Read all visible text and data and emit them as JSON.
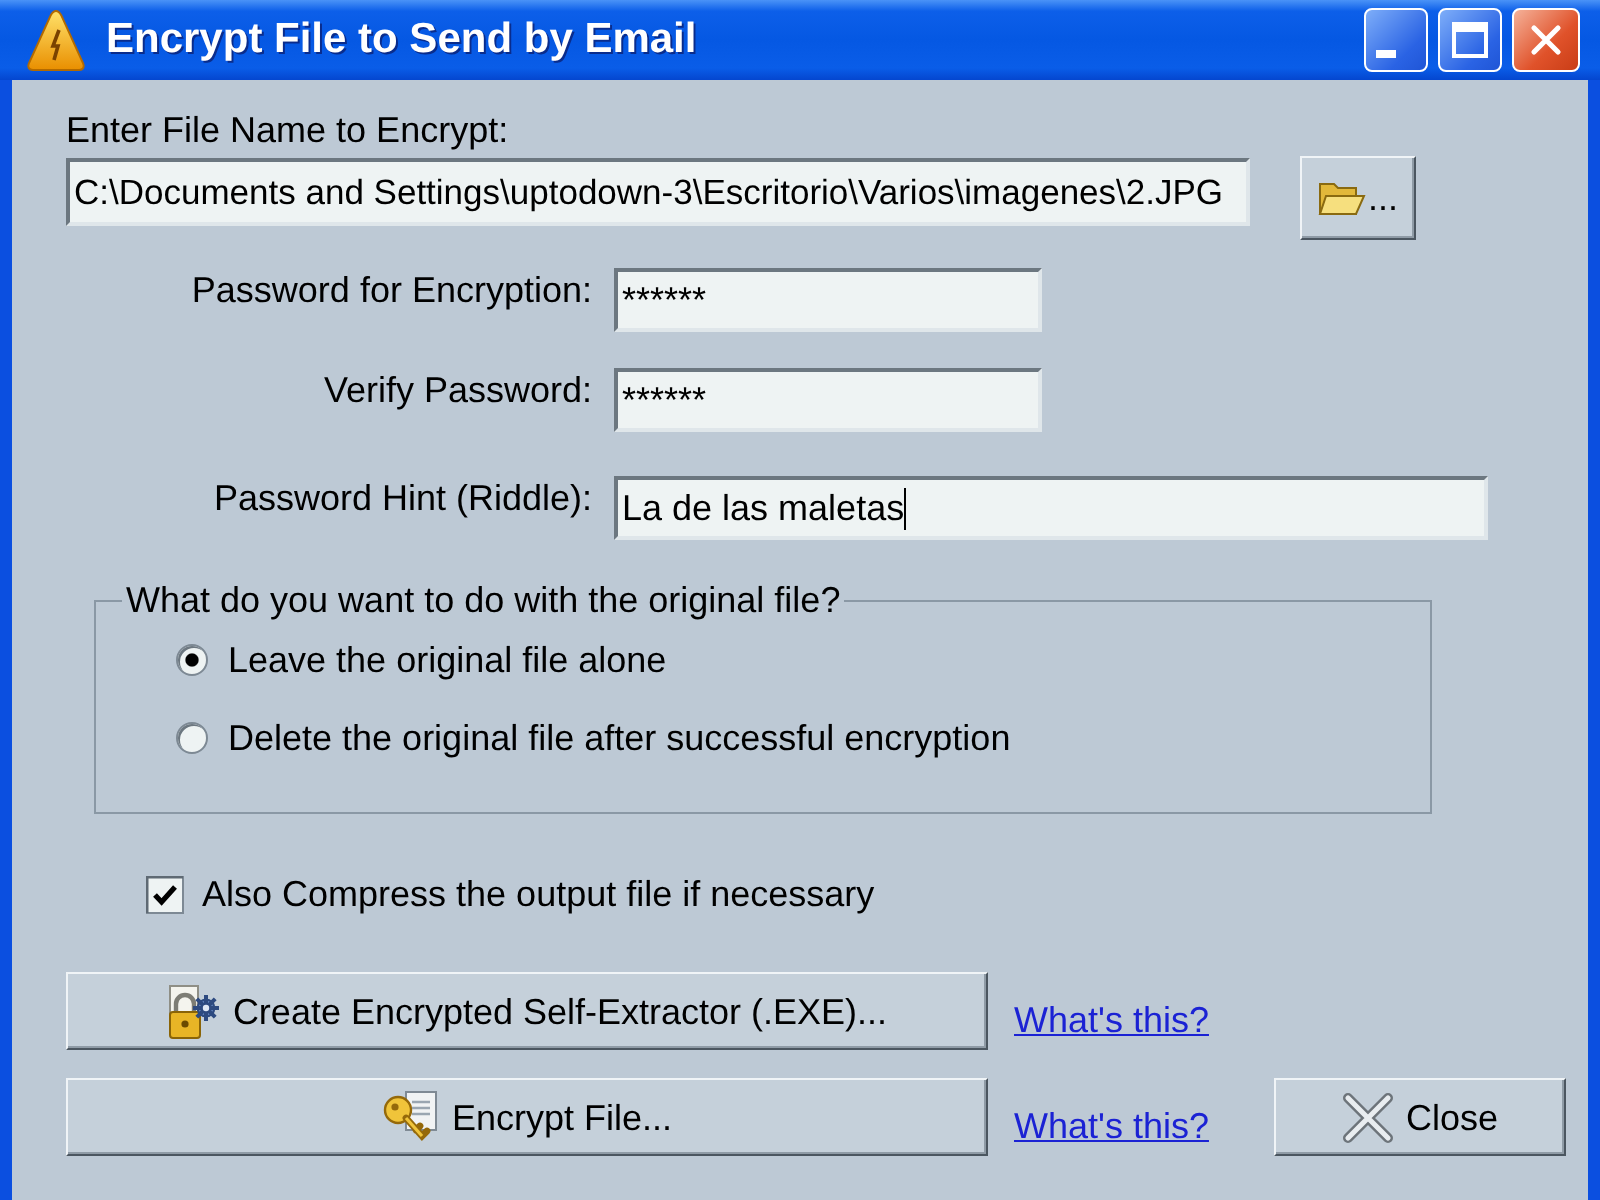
{
  "window": {
    "title": "Encrypt File to Send by Email"
  },
  "file_field": {
    "label": "Enter File Name to Encrypt:",
    "value": "C:\\Documents and Settings\\uptodown-3\\Escritorio\\Varios\\imagenes\\2.JPG",
    "browse_button": "..."
  },
  "password_fields": [
    {
      "label": "Password for Encryption:",
      "value": "******",
      "kind": "short",
      "focused": false
    },
    {
      "label": "Verify Password:",
      "value": "******",
      "kind": "short",
      "focused": false
    },
    {
      "label": "Password Hint (Riddle):",
      "value": "La de las maletas",
      "kind": "wide",
      "focused": true
    }
  ],
  "original_file_group": {
    "legend": "What do you want to do with the original file?",
    "options": [
      {
        "label": "Leave the original file alone",
        "selected": true
      },
      {
        "label": "Delete the original file after successful encryption",
        "selected": false
      }
    ]
  },
  "compress_option": {
    "label": "Also Compress the output file if necessary",
    "checked": true
  },
  "actions": [
    {
      "kind": "extractor",
      "label": "Create Encrypted Self-Extractor (.EXE)...",
      "help_link": "What's this?"
    },
    {
      "kind": "encrypt",
      "label": "Encrypt File...",
      "help_link": "What's this?"
    }
  ],
  "close_button": {
    "label": "Close"
  }
}
